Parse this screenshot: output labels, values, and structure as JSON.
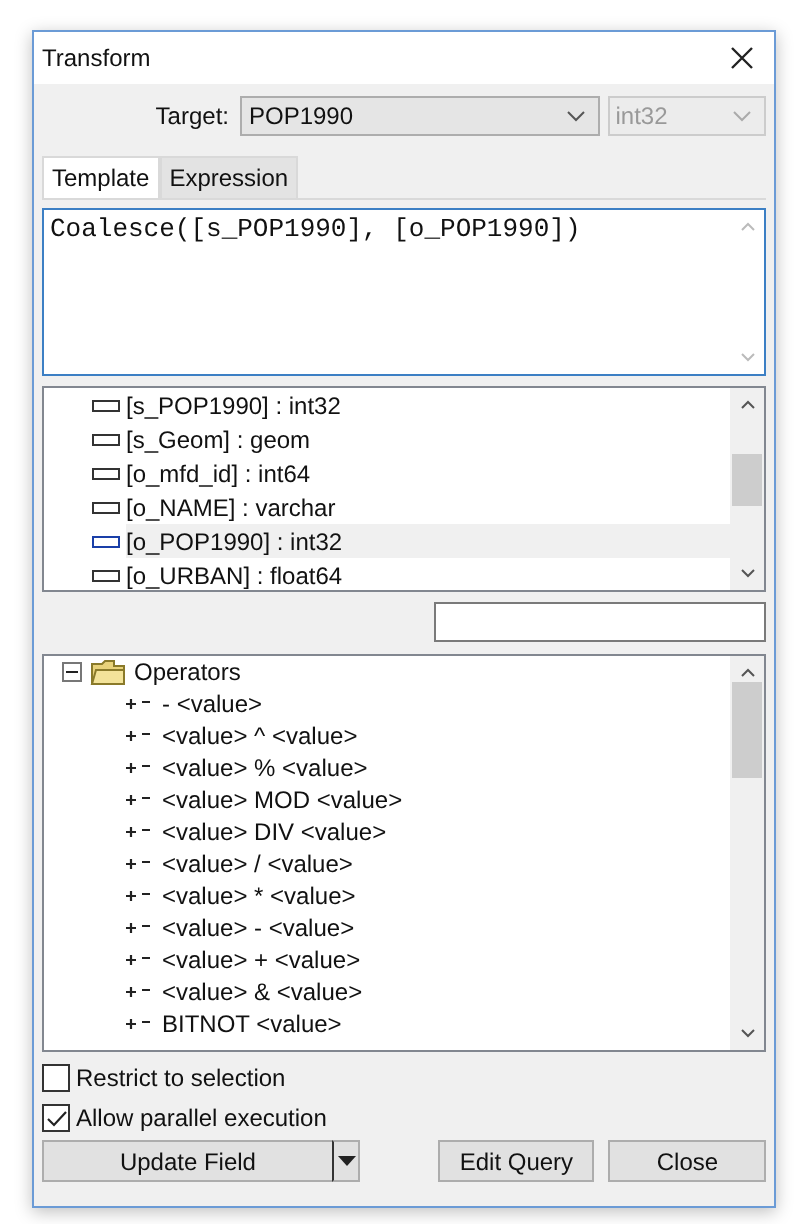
{
  "window": {
    "title": "Transform"
  },
  "target": {
    "label": "Target:",
    "value": "POP1990",
    "type": {
      "value": "int32",
      "disabled": true
    }
  },
  "tabs": [
    {
      "label": "Template",
      "selected": true
    },
    {
      "label": "Expression",
      "selected": false
    }
  ],
  "expression": "Coalesce([s_POP1990], [o_POP1990])",
  "fields": [
    {
      "label": "[s_POP1990] : int32",
      "selected": false
    },
    {
      "label": "[s_Geom] : geom",
      "selected": false
    },
    {
      "label": "[o_mfd_id] : int64",
      "selected": false
    },
    {
      "label": "[o_NAME] : varchar",
      "selected": false
    },
    {
      "label": "[o_POP1990] : int32",
      "selected": true
    },
    {
      "label": "[o_URBAN] : float64",
      "selected": false
    }
  ],
  "tree": [
    {
      "label": "Operators",
      "expanded": true,
      "children": [
        {
          "label": "- <value>"
        },
        {
          "label": "<value> ^ <value>"
        },
        {
          "label": "<value> % <value>"
        },
        {
          "label": "<value> MOD <value>"
        },
        {
          "label": "<value> DIV <value>"
        },
        {
          "label": "<value> / <value>"
        },
        {
          "label": "<value> * <value>"
        },
        {
          "label": "<value> - <value>"
        },
        {
          "label": "<value> + <value>"
        },
        {
          "label": "<value> & <value>"
        },
        {
          "label": "BITNOT <value>"
        }
      ]
    }
  ],
  "options": [
    {
      "label": "Restrict to selection",
      "checked": false
    },
    {
      "label": "Allow parallel execution",
      "checked": true
    }
  ],
  "buttons": {
    "update": "Update Field",
    "edit": "Edit Query",
    "close": "Close"
  }
}
